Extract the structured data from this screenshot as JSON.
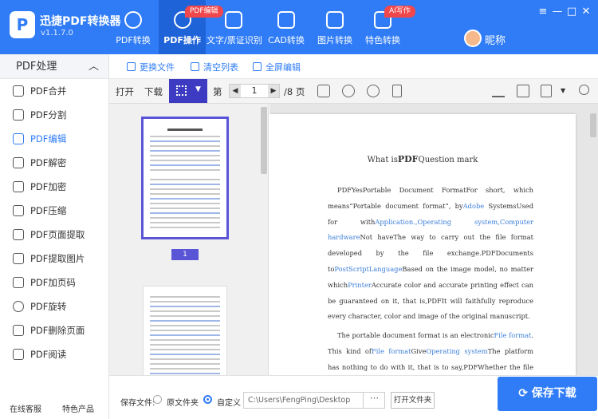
{
  "app": {
    "name": "迅捷PDF转换器",
    "version": "v1.1.7.0",
    "logo_letter": "P"
  },
  "tabs": [
    {
      "label": "PDF转换",
      "icon": "convert-icon"
    },
    {
      "label": "PDF操作",
      "icon": "pdf-operate-icon",
      "active": true,
      "badge": "PDF编辑"
    },
    {
      "label": "文字/票证识别",
      "icon": "ocr-icon"
    },
    {
      "label": "CAD转换",
      "icon": "cad-icon"
    },
    {
      "label": "图片转换",
      "icon": "image-icon"
    },
    {
      "label": "特色转换",
      "icon": "feature-icon",
      "badge": "AI写作"
    }
  ],
  "user": {
    "name": "昵称"
  },
  "window": {
    "menu": "≡",
    "minimize": "—",
    "maximize": "□",
    "close": "✕"
  },
  "sidebar": {
    "header": "PDF处理",
    "items": [
      {
        "label": "PDF合并",
        "icon": "merge-icon"
      },
      {
        "label": "PDF分割",
        "icon": "split-icon"
      },
      {
        "label": "PDF编辑",
        "icon": "edit-icon",
        "active": true
      },
      {
        "label": "PDF解密",
        "icon": "unlock-icon"
      },
      {
        "label": "PDF加密",
        "icon": "shield-icon"
      },
      {
        "label": "PDF压缩",
        "icon": "compress-icon"
      },
      {
        "label": "PDF页面提取",
        "icon": "page-extract-icon"
      },
      {
        "label": "PDF提取图片",
        "icon": "picture-icon"
      },
      {
        "label": "PDF加页码",
        "icon": "page-number-icon"
      },
      {
        "label": "PDF旋转",
        "icon": "rotate-icon"
      },
      {
        "label": "PDF删除页面",
        "icon": "delete-page-icon"
      },
      {
        "label": "PDF阅读",
        "icon": "book-icon"
      }
    ],
    "footer": {
      "service": "在线客服",
      "featured": "特色产品"
    }
  },
  "actions": {
    "replace": "更换文件",
    "clear": "清空列表",
    "fullscreen": "全屏编辑"
  },
  "viewer": {
    "open": "打开",
    "download": "下载",
    "page_prefix": "第",
    "page_current": "1",
    "page_total": "/8 页"
  },
  "thumbnail": {
    "page_label": "1"
  },
  "document": {
    "title_pre": "What is",
    "title_bold": "PDF",
    "title_post": "Question mark",
    "para1": [
      {
        "t": "PDFYesPortable Document FormatFor short, which means“Portable document format”, by"
      },
      {
        "t": "Adobe",
        "link": true
      },
      {
        "t": " SystemsUsed for with"
      },
      {
        "t": "Application.,Operating system,Computer hardware",
        "link": true
      },
      {
        "t": "Not haveThe way to carry out the file format developed by the file exchange.PDFDocuments to"
      },
      {
        "t": "PostScriptLanguage",
        "link": true
      },
      {
        "t": "Based on the image model, no matter which"
      },
      {
        "t": "Printer",
        "link": true
      },
      {
        "t": "Accurate color and accurate printing effect can be guaranteed on it, that is,PDFIt will faithfully reproduce every character, color and image of the original manuscript."
      }
    ],
    "para2": [
      {
        "t": "The portable document format is an electronic"
      },
      {
        "t": "File format",
        "link": true
      },
      {
        "t": ". This kind of"
      },
      {
        "t": "File format",
        "link": true
      },
      {
        "t": "Give"
      },
      {
        "t": "Operating system",
        "link": true
      },
      {
        "t": "The platform has nothing to do with it, that is to say,PDFWhether the file is"
      }
    ]
  },
  "bottom": {
    "save_to_label": "保存文件:",
    "option_source": "原文件夹",
    "option_custom": "自定义",
    "path": "C:\\Users\\FengPing\\Desktop",
    "dots": "···",
    "open_folder": "打开文件夹",
    "save_button": "保存下载"
  },
  "colors": {
    "brand": "#2f7cf6",
    "active_tab": "#1f63d8",
    "badge": "#f0474c",
    "grid_button": "#3d3bc2"
  }
}
